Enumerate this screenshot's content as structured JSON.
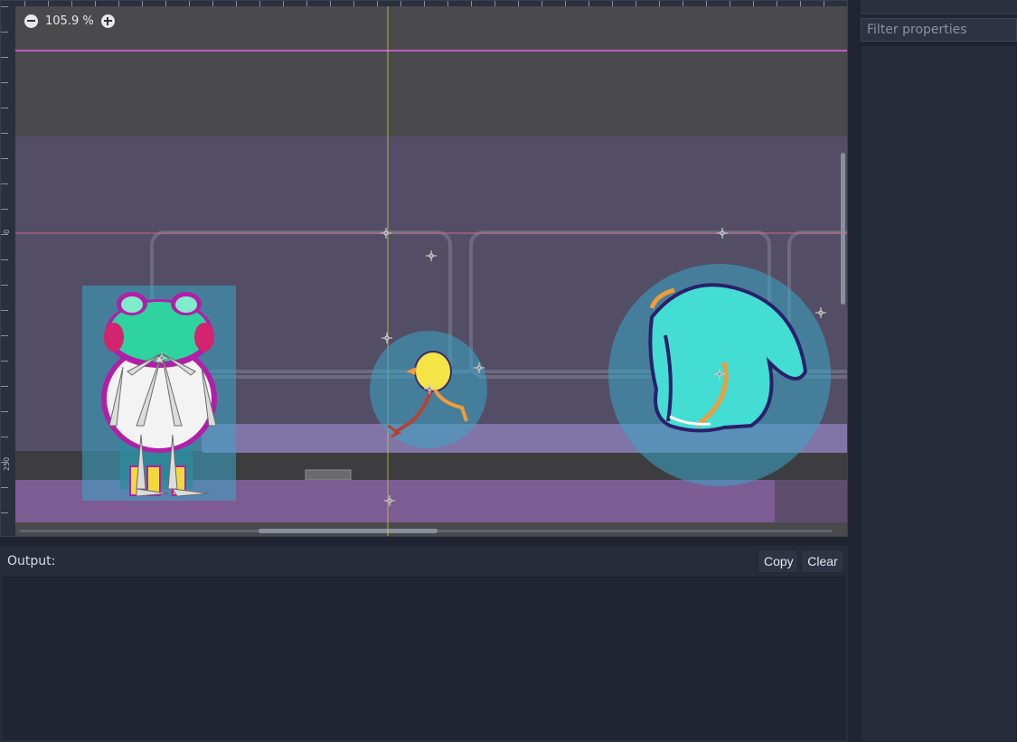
{
  "viewport": {
    "zoom_label": "105.9 %",
    "ruler_labels": [
      "0",
      "250"
    ]
  },
  "colors": {
    "ui_bg": "#202531",
    "panel_bg": "#262c3a",
    "canvas_bg": "#4a4a4c",
    "room_wall": "#534e66",
    "floor_strip": "#7d5c93",
    "platform": "#8174a7",
    "shape_overlay": "#3aa6c6",
    "guide_magenta": "#c45ac9",
    "guide_yellow": "#c8c84a",
    "character_green": "#2ed39f",
    "character_magenta": "#b31ea8",
    "bird_yellow": "#f4e446",
    "whale_cyan": "#43ddd4"
  },
  "output": {
    "label": "Output:",
    "copy_label": "Copy",
    "clear_label": "Clear"
  },
  "inspector": {
    "filter_placeholder": "Filter properties"
  }
}
